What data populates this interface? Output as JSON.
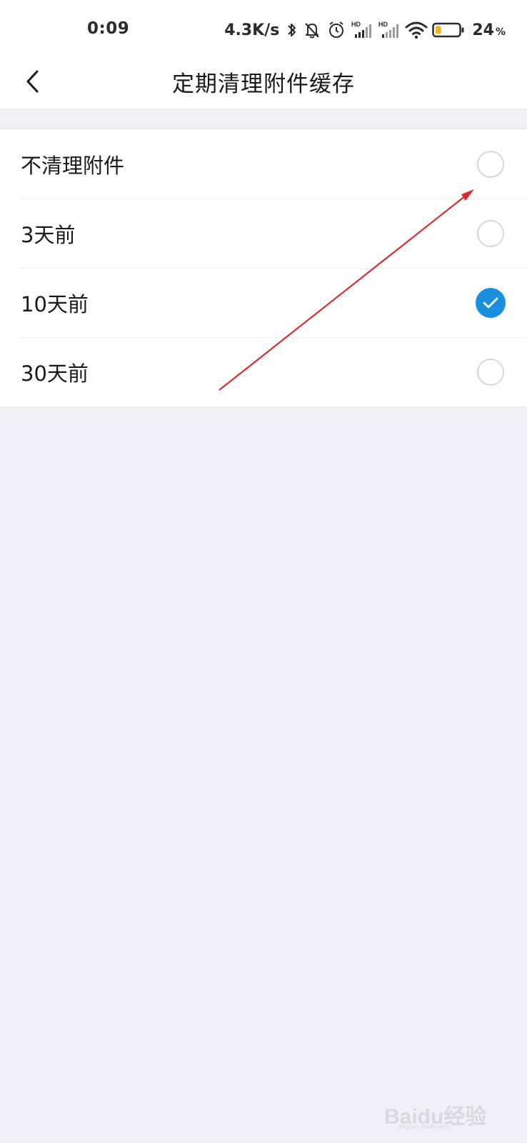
{
  "status_bar": {
    "time": "0:09",
    "net_speed": "4.3K/s",
    "battery_percent": "24",
    "battery_unit": "%",
    "battery_level": 0.24,
    "icons": [
      "bluetooth-icon",
      "mute-bell-icon",
      "alarm-icon",
      "hd-signal-icon",
      "hd-signal-icon",
      "wifi-icon",
      "battery-icon"
    ]
  },
  "nav": {
    "title": "定期清理附件缓存",
    "back_icon": "chevron-left-icon"
  },
  "options": [
    {
      "label": "不清理附件",
      "selected": false
    },
    {
      "label": "3天前",
      "selected": false
    },
    {
      "label": "10天前",
      "selected": true
    },
    {
      "label": "30天前",
      "selected": false
    }
  ],
  "colors": {
    "accent": "#1a8fe0",
    "background": "#f0f1f4",
    "annotation_arrow": "#d92a2a"
  },
  "watermark": {
    "brand": "Baidu经验",
    "sub": "jingyan.baidu.com"
  }
}
